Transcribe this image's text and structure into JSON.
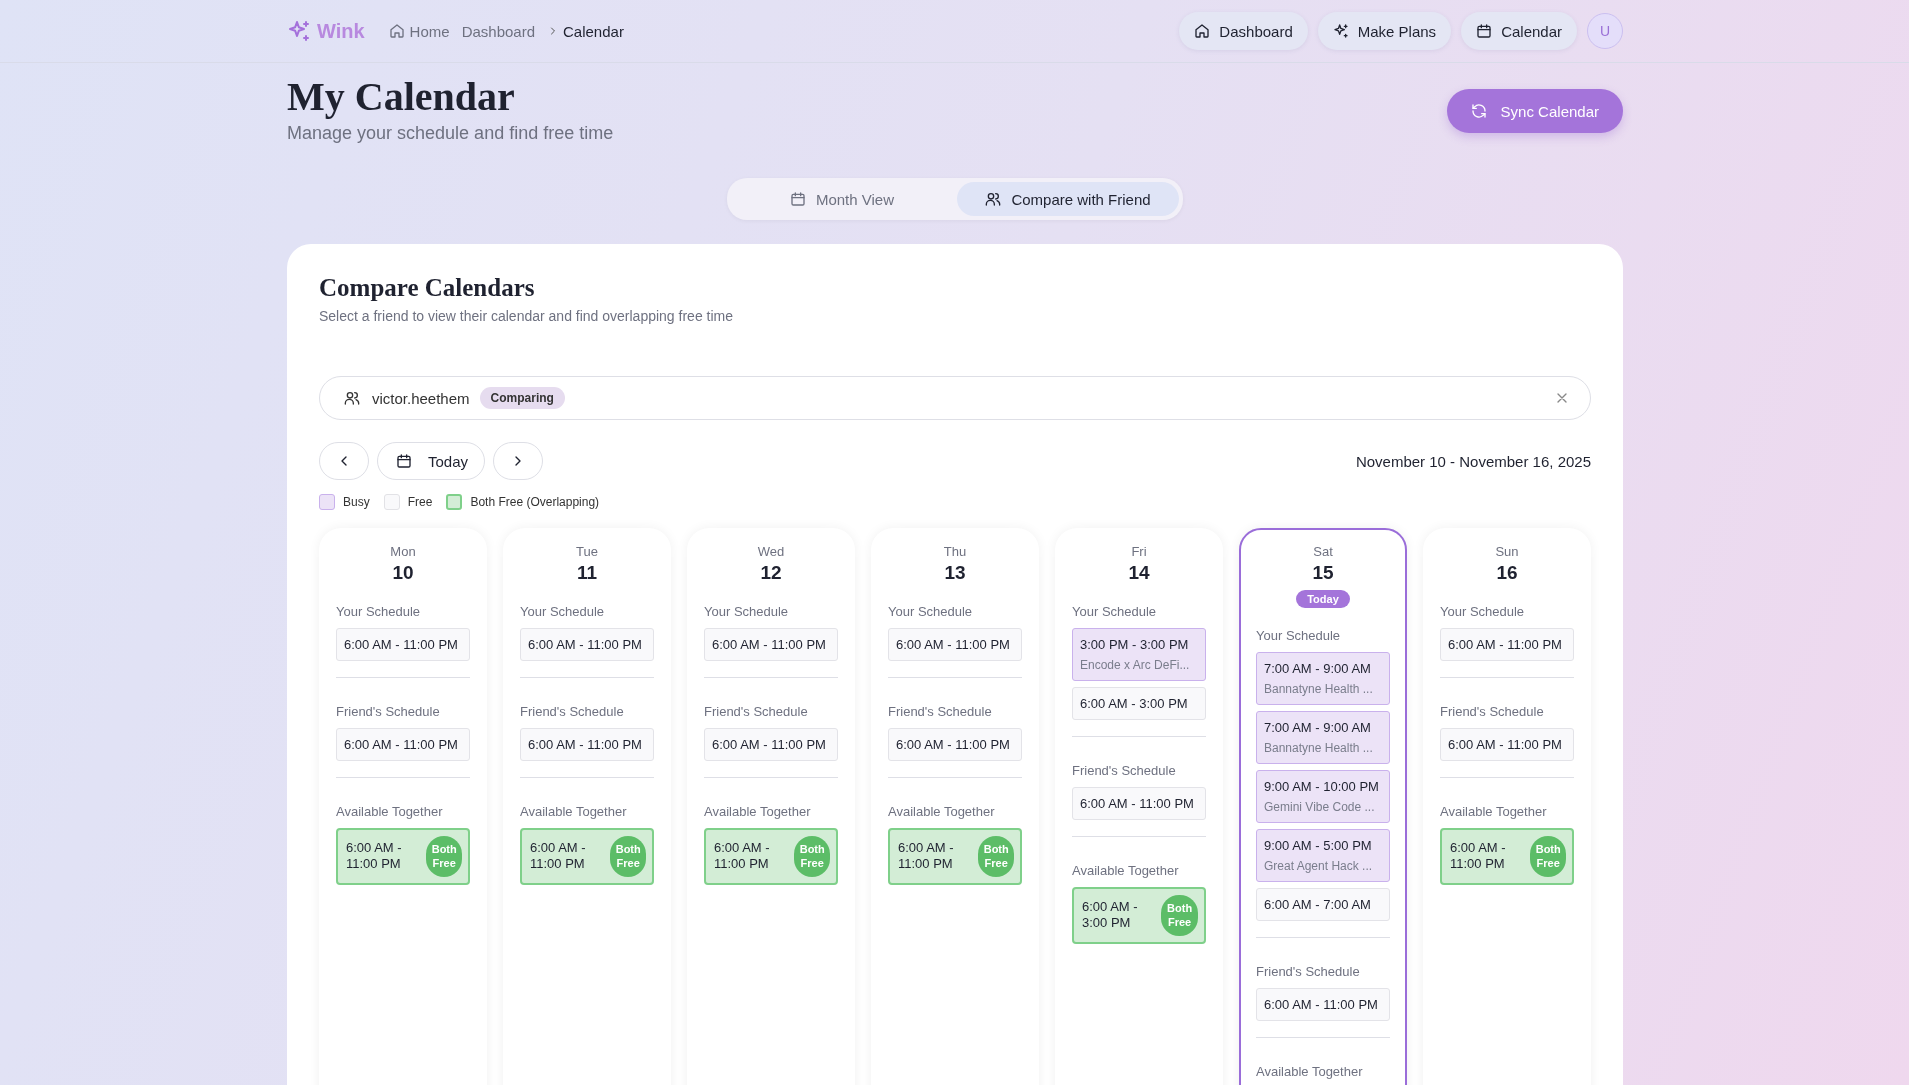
{
  "brand": "Wink",
  "breadcrumb": [
    {
      "label": "Home",
      "kind": "home"
    },
    {
      "label": "Dashboard",
      "kind": "link"
    },
    {
      "label": "Calendar",
      "kind": "current"
    }
  ],
  "nav": [
    {
      "label": "Dashboard",
      "kind": "home"
    },
    {
      "label": "Make Plans",
      "kind": "plans"
    },
    {
      "label": "Calendar",
      "kind": "calendar"
    }
  ],
  "avatar": "U",
  "page": {
    "title": "My Calendar",
    "subtitle": "Manage your schedule and find free time",
    "sync_button": "Sync Calendar"
  },
  "tabs": [
    {
      "label": "Month View",
      "kind": "month",
      "selected": false
    },
    {
      "label": "Compare with Friend",
      "kind": "compare",
      "selected": true
    }
  ],
  "compare": {
    "title": "Compare Calendars",
    "subtitle": "Select a friend to view their calendar and find overlapping free time",
    "friend": {
      "name": "victor.heethem",
      "badge": "Comparing"
    },
    "today_button": "Today",
    "range": "November 10 - November 16, 2025",
    "legend": [
      {
        "label": "Busy",
        "kind": "busy"
      },
      {
        "label": "Free",
        "kind": "free"
      },
      {
        "label": "Both Free (Overlapping)",
        "kind": "both"
      }
    ],
    "days": [
      {
        "weekday": "Mon",
        "date": "10",
        "today": false,
        "your_label": "Your Schedule",
        "your": [
          {
            "time": "6:00 AM - 11:00 PM",
            "kind": "free"
          }
        ],
        "friend_label": "Friend's Schedule",
        "friend": [
          {
            "time": "6:00 AM - 11:00 PM",
            "kind": "free"
          }
        ],
        "together_label": "Available Together",
        "together": [
          {
            "time": "6:00 AM - 11:00 PM",
            "badge": "Both Free"
          }
        ]
      },
      {
        "weekday": "Tue",
        "date": "11",
        "today": false,
        "your_label": "Your Schedule",
        "your": [
          {
            "time": "6:00 AM - 11:00 PM",
            "kind": "free"
          }
        ],
        "friend_label": "Friend's Schedule",
        "friend": [
          {
            "time": "6:00 AM - 11:00 PM",
            "kind": "free"
          }
        ],
        "together_label": "Available Together",
        "together": [
          {
            "time": "6:00 AM - 11:00 PM",
            "badge": "Both Free"
          }
        ]
      },
      {
        "weekday": "Wed",
        "date": "12",
        "today": false,
        "your_label": "Your Schedule",
        "your": [
          {
            "time": "6:00 AM - 11:00 PM",
            "kind": "free"
          }
        ],
        "friend_label": "Friend's Schedule",
        "friend": [
          {
            "time": "6:00 AM - 11:00 PM",
            "kind": "free"
          }
        ],
        "together_label": "Available Together",
        "together": [
          {
            "time": "6:00 AM - 11:00 PM",
            "badge": "Both Free"
          }
        ]
      },
      {
        "weekday": "Thu",
        "date": "13",
        "today": false,
        "your_label": "Your Schedule",
        "your": [
          {
            "time": "6:00 AM - 11:00 PM",
            "kind": "free"
          }
        ],
        "friend_label": "Friend's Schedule",
        "friend": [
          {
            "time": "6:00 AM - 11:00 PM",
            "kind": "free"
          }
        ],
        "together_label": "Available Together",
        "together": [
          {
            "time": "6:00 AM - 11:00 PM",
            "badge": "Both Free"
          }
        ]
      },
      {
        "weekday": "Fri",
        "date": "14",
        "today": false,
        "your_label": "Your Schedule",
        "your": [
          {
            "time": "3:00 PM - 3:00 PM",
            "title": "Encode x Arc DeFi...",
            "kind": "busy"
          },
          {
            "time": "6:00 AM - 3:00 PM",
            "kind": "free"
          }
        ],
        "friend_label": "Friend's Schedule",
        "friend": [
          {
            "time": "6:00 AM - 11:00 PM",
            "kind": "free"
          }
        ],
        "together_label": "Available Together",
        "together": [
          {
            "time": "6:00 AM - 3:00 PM",
            "badge": "Both Free"
          }
        ]
      },
      {
        "weekday": "Sat",
        "date": "15",
        "today": true,
        "today_badge": "Today",
        "your_label": "Your Schedule",
        "your": [
          {
            "time": "7:00 AM - 9:00 AM",
            "title": "Bannatyne Health ...",
            "kind": "busy"
          },
          {
            "time": "7:00 AM - 9:00 AM",
            "title": "Bannatyne Health ...",
            "kind": "busy"
          },
          {
            "time": "9:00 AM - 10:00 PM",
            "title": "Gemini Vibe Code ...",
            "kind": "busy"
          },
          {
            "time": "9:00 AM - 5:00 PM",
            "title": "Great Agent Hack ...",
            "kind": "busy"
          },
          {
            "time": "6:00 AM - 7:00 AM",
            "kind": "free"
          }
        ],
        "friend_label": "Friend's Schedule",
        "friend": [
          {
            "time": "6:00 AM - 11:00 PM",
            "kind": "free"
          }
        ],
        "together_label": "Available Together"
      },
      {
        "weekday": "Sun",
        "date": "16",
        "today": false,
        "your_label": "Your Schedule",
        "your": [
          {
            "time": "6:00 AM - 11:00 PM",
            "kind": "free"
          }
        ],
        "friend_label": "Friend's Schedule",
        "friend": [
          {
            "time": "6:00 AM - 11:00 PM",
            "kind": "free"
          }
        ],
        "together_label": "Available Together",
        "together": [
          {
            "time": "6:00 AM - 11:00 PM",
            "badge": "Both Free"
          }
        ]
      }
    ]
  }
}
